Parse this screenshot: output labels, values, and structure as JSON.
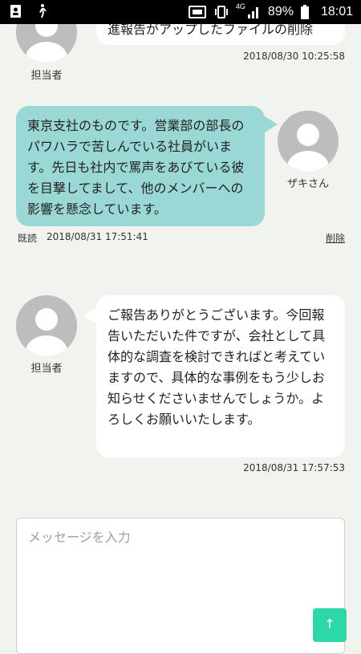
{
  "status_bar": {
    "battery_percent": "89%",
    "time": "18:01",
    "network": "4G"
  },
  "messages": [
    {
      "sender": "担当者",
      "text": "進報告がアップしたファイルの削除",
      "timestamp": "2018/08/30 10:25:58"
    },
    {
      "sender": "ザキさん",
      "text": "東京支社のものです。営業部の部長のパワハラで苦しんでいる社員がいます。先日も社内で罵声をあびている彼を目撃してまして、他のメンバーへの影響を懸念しています。",
      "read_label": "既読",
      "timestamp": "2018/08/31 17:51:41",
      "delete_label": "削除"
    },
    {
      "sender": "担当者",
      "text": "ご報告ありがとうございます。今回報告いただいた件ですが、会社として具体的な調査を検討できればと考えていますので、具体的な事例をもう少しお知らせくださいませんでしょうか。よろしくお願いいたします。",
      "timestamp": "2018/08/31 17:57:53"
    }
  ],
  "composer": {
    "placeholder": "メッセージを入力",
    "send_label": "↑"
  }
}
